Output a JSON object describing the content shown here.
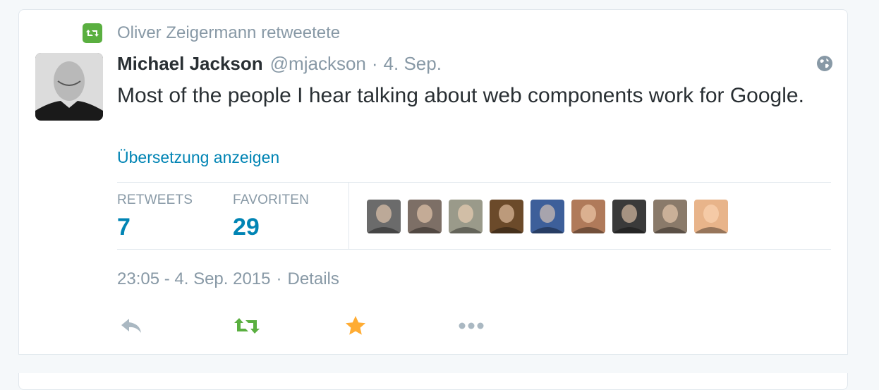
{
  "context": {
    "text": "Oliver Zeigermann retweetete",
    "icon": "retweet-icon"
  },
  "tweet": {
    "fullname": "Michael Jackson",
    "handle": "@mjackson",
    "separator": "·",
    "date": "4. Sep.",
    "text": "Most of the people I hear talking about web components work for Google.",
    "translate_link": "Übersetzung anzeigen"
  },
  "stats": {
    "retweets_label": "RETWEETS",
    "retweets_value": "7",
    "favorites_label": "FAVORITEN",
    "favorites_value": "29"
  },
  "faces": [
    {
      "name": "face-1",
      "color": "#6b6b6b"
    },
    {
      "name": "face-2",
      "color": "#7d6f66"
    },
    {
      "name": "face-3",
      "color": "#9a9a8a"
    },
    {
      "name": "face-4",
      "color": "#6b4a2a"
    },
    {
      "name": "face-5",
      "color": "#3d5f9a"
    },
    {
      "name": "face-6",
      "color": "#b07a5a"
    },
    {
      "name": "face-7",
      "color": "#3a3a3a"
    },
    {
      "name": "face-8",
      "color": "#8a7a6a"
    },
    {
      "name": "face-9",
      "color": "#e8b48a"
    }
  ],
  "timestamp": {
    "time": "23:05 - 4. Sep. 2015",
    "separator": "·",
    "details": "Details"
  },
  "actions": [
    {
      "icon": "reply-icon",
      "color": "#aab8c2"
    },
    {
      "icon": "retweet-icon",
      "color": "#5aaf40"
    },
    {
      "icon": "star-icon",
      "color": "#ffac33"
    },
    {
      "icon": "more-icon",
      "color": "#aab8c2"
    }
  ],
  "colors": {
    "link": "#0084b4",
    "muted": "#8899a6",
    "retweet_green": "#5aaf40",
    "favorite_gold": "#ffac33"
  }
}
